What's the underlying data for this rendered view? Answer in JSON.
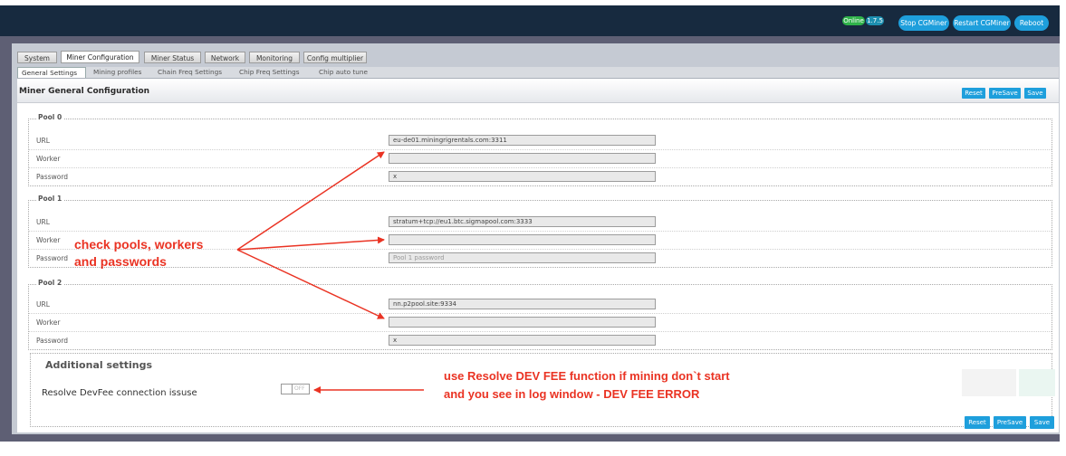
{
  "header": {
    "status_online": "Online",
    "version": "1.7.5",
    "buttons": {
      "stop": "Stop CGMiner",
      "restart": "Restart CGMiner",
      "reboot": "Reboot"
    }
  },
  "tabs": [
    "System",
    "Miner Configuration",
    "Miner Status",
    "Network",
    "Monitoring",
    "Config multiplier"
  ],
  "subtabs": [
    "General Settings",
    "Mining profiles",
    "Chain Freq Settings",
    "Chip Freq Settings",
    "Chip auto tune"
  ],
  "panel": {
    "title": "Miner General Configuration",
    "reset": "Reset",
    "presave": "PreSave",
    "save": "Save"
  },
  "field_labels": {
    "url": "URL",
    "worker": "Worker",
    "password": "Password"
  },
  "pools": [
    {
      "name": "Pool 0",
      "url": "eu-de01.miningrigrentals.com:3311",
      "worker": "",
      "password": "x",
      "password_placeholder": ""
    },
    {
      "name": "Pool 1",
      "url": "stratum+tcp://eu1.btc.sigmapool.com:3333",
      "worker": "",
      "password": "",
      "password_placeholder": "Pool 1 password"
    },
    {
      "name": "Pool 2",
      "url": "nn.p2pool.site:9334",
      "worker": "",
      "password": "x",
      "password_placeholder": ""
    }
  ],
  "additional": {
    "title": "Additional settings",
    "devfee_label": "Resolve DevFee connection issuse",
    "toggle_state": "OFF"
  },
  "annotations": {
    "pools_note_line1": "check pools, workers",
    "pools_note_line2": "and passwords",
    "devfee_note_line1": "use Resolve DEV FEE function if mining don`t start",
    "devfee_note_line2": "and you see in log window - DEV FEE ERROR"
  },
  "colors": {
    "accent": "#1e9fdc",
    "topbar": "#172a3f",
    "annotation": "#ea3323",
    "online": "#2fb34a",
    "version": "#1c8fb0"
  }
}
